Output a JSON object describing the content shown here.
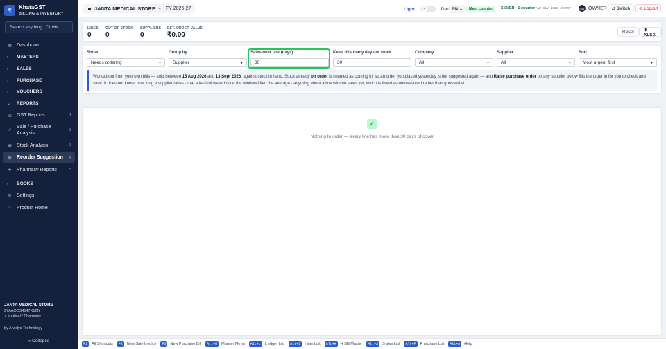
{
  "brand": {
    "logo": "₹",
    "title": "KhataGST",
    "subtitle": "BILLING & INVENTORY"
  },
  "search": {
    "placeholder": "Search anything",
    "shortcut": "Ctrl+K"
  },
  "nav": {
    "dashboard": "Dashboard",
    "masters": "MASTERS",
    "sales": "SALES",
    "purchase": "PURCHASE",
    "vouchers": "VOUCHERS",
    "reports": "REPORTS",
    "gst": "GST Reports",
    "gst_num": "1",
    "salepur": "Sale / Purchase Analysis",
    "salepur_num": "2",
    "stock": "Stock Analysis",
    "stock_num": "3",
    "reorder": "Reorder Suggestion",
    "reorder_num": "4",
    "pharmacy": "Pharmacy Reports",
    "pharmacy_num": "5",
    "books": "BOOKS",
    "settings": "Settings",
    "product_home": "Product Home"
  },
  "sidebar_footer": {
    "store": "JANTA MEDICAL STORE",
    "gstin": "27AAQCS4547K1ZN",
    "category": "Medical / Pharmacy",
    "vendor": "by Anedya Technology",
    "collapse": "« Collapse"
  },
  "topbar": {
    "store": "JANTA MEDICAL STORE",
    "fy": "FY 2026-27",
    "light": "Light",
    "dark": "Dark",
    "lang": "EN",
    "counter": "Main counter",
    "silver": "SILVER · 1 counter",
    "license": "ANO-SLV-2026-4E7F97",
    "avatar": "OW",
    "owner": "OWNER",
    "switch": "⇄ Switch",
    "logout": "⊘ Logout"
  },
  "stats": [
    {
      "k": "LINES",
      "v": "0"
    },
    {
      "k": "OUT OF STOCK",
      "v": "0"
    },
    {
      "k": "SUPPLIERS",
      "v": "0"
    },
    {
      "k": "EST. ORDER VALUE",
      "v": "₹0.00"
    }
  ],
  "actions": {
    "reset": "Reset",
    "xlsx": "⬇ XLSX"
  },
  "filters": {
    "show": {
      "label": "Show",
      "value": "Needs ordering"
    },
    "group": {
      "label": "Group by",
      "value": "Supplier"
    },
    "sales_days": {
      "label": "Sales over last (days)",
      "value": "30"
    },
    "keep_days": {
      "label": "Keep this many days of stock",
      "value": "30"
    },
    "company": {
      "label": "Company",
      "value": "All"
    },
    "supplier": {
      "label": "Supplier",
      "value": "All"
    },
    "sort": {
      "label": "Sort",
      "value": "Most urgent first"
    }
  },
  "note": {
    "p1": "Worked out from your own bills — sold between ",
    "d1": "15 Aug 2026",
    "p2": " and ",
    "d2": "13 Sept 2026",
    "p3": ", against stock in hand. Stock already ",
    "b1": "on order",
    "p4": " is counted as coming in, so an order you placed yesterday is not suggested again — and ",
    "b2": "Raise purchase order",
    "p5": " on any supplier below fills the order in for you to check and save. It does not know: how long a supplier takes · that a festival week inside the window lifted the average · anything about a line with no sales yet, which is listed as unmeasured rather than guessed at."
  },
  "empty": {
    "message": "Nothing to order — every line has more than 30 days of cover."
  },
  "shortcuts": [
    {
      "key": "F1",
      "label": "All Shortcuts"
    },
    {
      "key": "F2",
      "label": "New Sale Invoice"
    },
    {
      "key": "F3",
      "label": "New Purchase Bill"
    },
    {
      "key": "Alt+M",
      "label": "M aster Menu"
    },
    {
      "key": "Alt+L",
      "label": "L edger List"
    },
    {
      "key": "Alt+I",
      "label": "I tem List"
    },
    {
      "key": "Alt+H",
      "label": "H SN Master"
    },
    {
      "key": "Alt+S",
      "label": "S ales List"
    },
    {
      "key": "Alt+P",
      "label": "P urchase List"
    },
    {
      "key": "Alt+A",
      "label": "Help"
    }
  ],
  "colors": {
    "sidebar": "#14213d",
    "accent": "#2b5cc7",
    "highlight": "#22c55e",
    "logout": "#dc2626"
  }
}
